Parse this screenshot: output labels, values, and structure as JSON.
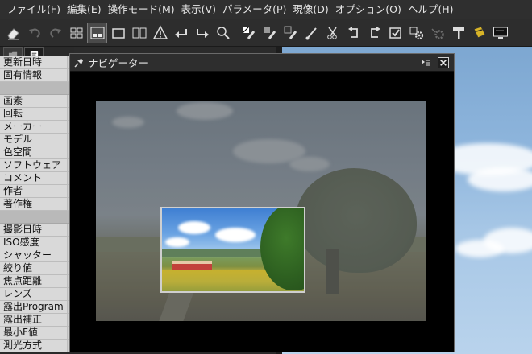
{
  "menu": [
    "ファイル(F)",
    "編集(E)",
    "操作モード(M)",
    "表示(V)",
    "パラメータ(P)",
    "現像(D)",
    "オプション(O)",
    "ヘルプ(H)"
  ],
  "toolbar": {
    "icons": [
      "eraser-icon",
      "undo-icon",
      "redo-icon",
      "grid-view-icon",
      "split-view-icon",
      "single-view-icon",
      "compare-view-icon",
      "warning-icon",
      "rotate-left-icon",
      "rotate-right-icon",
      "zoom-icon",
      "white-balance-picker-icon",
      "gray-picker-icon",
      "color-picker-icon",
      "brush-icon",
      "crop-icon",
      "rotate-ccw-icon",
      "rotate-cw-icon",
      "checkbox-icon",
      "settings-gear-icon",
      "gear-disabled-icon",
      "hammer-icon",
      "badge-icon",
      "monitor-icon"
    ],
    "active_index": 4
  },
  "left_panel": {
    "tabs": [
      "folder-tab",
      "info-tab"
    ],
    "rows_top": [
      "更新日時",
      "固有情報"
    ],
    "rows_mid": [
      "画素",
      "回転",
      "メーカー",
      "モデル",
      "色空間",
      "ソフトウェア",
      "コメント",
      "作者",
      "著作権"
    ],
    "rows_bottom": [
      "撮影日時",
      "ISO感度",
      "シャッター",
      "絞り値",
      "焦点距離",
      "レンズ",
      "露出Program",
      "露出補正",
      "最小F値",
      "測光方式"
    ]
  },
  "navigator": {
    "title": "ナビゲーター"
  },
  "colors": {
    "menu_bg": "#2f2f2f",
    "panel_row_bg": "#d9d9d9",
    "navigator_bg": "#000000"
  }
}
